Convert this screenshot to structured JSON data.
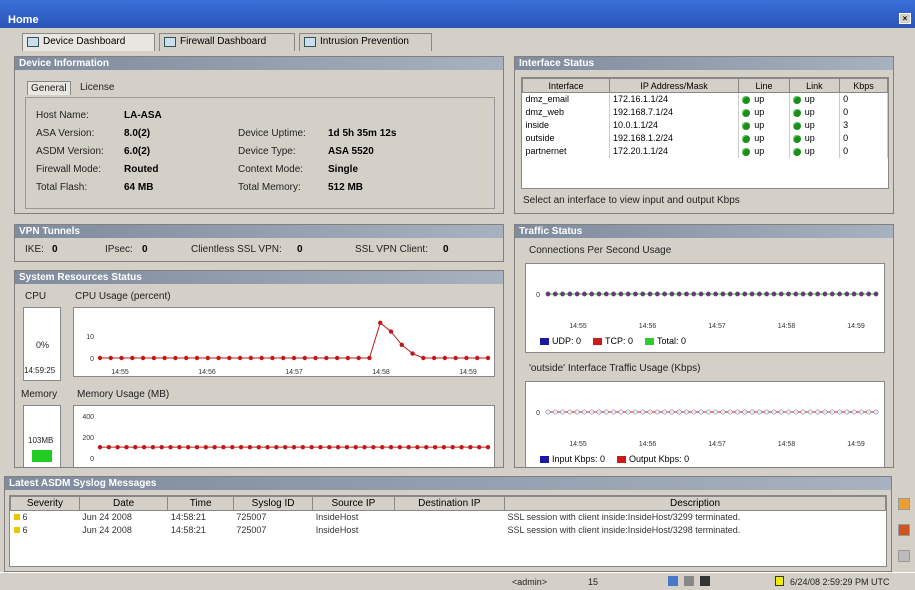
{
  "window": {
    "title": "Home"
  },
  "tabs": [
    {
      "label": "Device Dashboard",
      "icon": "dashboard-icon",
      "active": true
    },
    {
      "label": "Firewall Dashboard",
      "icon": "firewall-icon",
      "active": false
    },
    {
      "label": "Intrusion Prevention",
      "icon": "ips-icon",
      "active": false
    }
  ],
  "device_info": {
    "title": "Device Information",
    "subtabs": [
      "General",
      "License"
    ],
    "left": [
      {
        "label": "Host Name:",
        "value": "LA-ASA"
      },
      {
        "label": "ASA Version:",
        "value": "8.0(2)"
      },
      {
        "label": "ASDM Version:",
        "value": "6.0(2)"
      },
      {
        "label": "Firewall Mode:",
        "value": "Routed"
      },
      {
        "label": "Total Flash:",
        "value": "64 MB"
      }
    ],
    "right": [
      {
        "label": "Device Uptime:",
        "value": "1d 5h 35m 12s"
      },
      {
        "label": "Device Type:",
        "value": "ASA 5520"
      },
      {
        "label": "Context Mode:",
        "value": "Single"
      },
      {
        "label": "Total Memory:",
        "value": "512 MB"
      }
    ]
  },
  "vpn": {
    "title": "VPN Tunnels",
    "items": [
      {
        "label": "IKE:",
        "value": "0"
      },
      {
        "label": "IPsec:",
        "value": "0"
      },
      {
        "label": "Clientless SSL VPN:",
        "value": "0"
      },
      {
        "label": "SSL VPN Client:",
        "value": "0"
      }
    ]
  },
  "sysres": {
    "title": "System Resources Status",
    "cpu_label": "CPU",
    "cpu_value": "0%",
    "cpu_time": "14:59:25",
    "cpu_chart_title": "CPU Usage (percent)",
    "mem_label": "Memory",
    "mem_value": "103MB",
    "mem_chart_title": "Memory Usage (MB)"
  },
  "interfaces": {
    "title": "Interface Status",
    "columns": [
      "Interface",
      "IP Address/Mask",
      "Line",
      "Link",
      "Kbps"
    ],
    "rows": [
      [
        "dmz_email",
        "172.16.1.1/24",
        "up",
        "up",
        "0"
      ],
      [
        "dmz_web",
        "192.168.7.1/24",
        "up",
        "up",
        "0"
      ],
      [
        "inside",
        "10.0.1.1/24",
        "up",
        "up",
        "3"
      ],
      [
        "outside",
        "192.168.1.2/24",
        "up",
        "up",
        "0"
      ],
      [
        "partnernet",
        "172.20.1.1/24",
        "up",
        "up",
        "0"
      ]
    ],
    "hint": "Select an interface to view input and output Kbps"
  },
  "traffic": {
    "title": "Traffic Status",
    "conn_title": "Connections Per Second Usage",
    "conn_legend": [
      {
        "name": "UDP: 0",
        "color": "#1a1aa0"
      },
      {
        "name": "TCP: 0",
        "color": "#cc1a1a"
      },
      {
        "name": "Total: 0",
        "color": "#2ecc2e"
      }
    ],
    "iface_title": "'outside' Interface Traffic Usage (Kbps)",
    "iface_legend": [
      {
        "name": "Input Kbps: 0",
        "color": "#1a1aa0"
      },
      {
        "name": "Output Kbps: 0",
        "color": "#cc1a1a"
      }
    ]
  },
  "syslog": {
    "title": "Latest ASDM Syslog Messages",
    "columns": [
      "Severity",
      "Date",
      "Time",
      "Syslog ID",
      "Source IP",
      "Destination IP",
      "Description"
    ],
    "rows": [
      [
        "6",
        "Jun 24 2008",
        "14:58:21",
        "725007",
        "InsideHost",
        "",
        "SSL session with client inside:InsideHost/3299 terminated."
      ],
      [
        "6",
        "Jun 24 2008",
        "14:58:21",
        "725007",
        "InsideHost",
        "",
        "SSL session with client inside:InsideHost/3298 terminated."
      ]
    ]
  },
  "status": {
    "user": "<admin>",
    "count": "15",
    "datetime": "6/24/08 2:59:29 PM UTC"
  },
  "chart_data": [
    {
      "type": "line",
      "title": "CPU Usage (percent)",
      "x": [
        "14:55",
        "14:56",
        "14:57",
        "14:58",
        "14:59"
      ],
      "ylim": [
        0,
        20
      ],
      "yticks": [
        "10",
        "0"
      ],
      "series": [
        {
          "values": [
            0,
            0,
            0,
            0,
            0,
            0,
            0,
            0,
            0,
            0,
            0,
            0,
            0,
            0,
            0,
            0,
            0,
            0,
            0,
            0,
            0,
            0,
            0,
            0,
            0,
            0,
            16,
            12,
            6,
            2,
            0,
            0,
            0,
            0,
            0,
            0,
            0
          ]
        }
      ]
    },
    {
      "type": "line",
      "title": "Memory Usage (MB)",
      "x": [
        "14:55",
        "14:56",
        "14:57",
        "14:58",
        "14:59"
      ],
      "ylim": [
        0,
        400
      ],
      "yticks": [
        "400",
        "200",
        "0"
      ],
      "series": [
        {
          "values": [
            103,
            103,
            103,
            103,
            103,
            103,
            103,
            103,
            103,
            103,
            103,
            103,
            103,
            103,
            103,
            103,
            103,
            103,
            103,
            103,
            103,
            103,
            103,
            103,
            103,
            103,
            103,
            103,
            103,
            103,
            103,
            103,
            103,
            103,
            103,
            103,
            103,
            103,
            103,
            103,
            103,
            103,
            103,
            103,
            103
          ]
        }
      ]
    },
    {
      "type": "line",
      "title": "Connections Per Second Usage",
      "x": [
        "14:55",
        "14:56",
        "14:57",
        "14:58",
        "14:59"
      ],
      "yticks": [
        "0"
      ],
      "series": [
        {
          "name": "UDP: 0",
          "values": [
            0
          ]
        },
        {
          "name": "TCP: 0",
          "values": [
            0
          ]
        },
        {
          "name": "Total: 0",
          "values": [
            0
          ]
        }
      ]
    },
    {
      "type": "line",
      "title": "'outside' Interface Traffic Usage (Kbps)",
      "x": [
        "14:55",
        "14:56",
        "14:57",
        "14:58",
        "14:59"
      ],
      "yticks": [
        "0"
      ],
      "series": [
        {
          "name": "Input Kbps: 0",
          "values": [
            0
          ]
        },
        {
          "name": "Output Kbps: 0",
          "values": [
            0
          ]
        }
      ]
    }
  ]
}
